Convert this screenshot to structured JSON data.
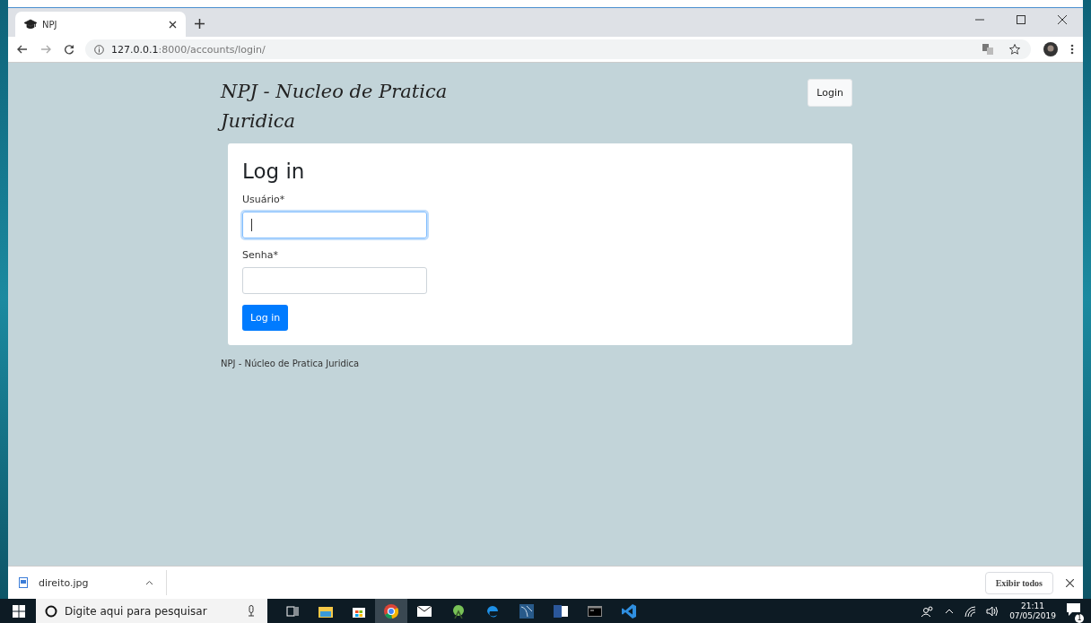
{
  "browser": {
    "tab": {
      "title": "NPJ",
      "selected": true
    },
    "url_host": "127.0.0.1",
    "url_path": ":8000/accounts/login/"
  },
  "page": {
    "brand": "NPJ - Nucleo de Pratica Juridica",
    "nav_button": "Login",
    "card": {
      "title": "Log in",
      "fields": [
        {
          "label": "Usuário*",
          "focused": true,
          "caret": true
        },
        {
          "label": "Senha*",
          "focused": false,
          "caret": false
        }
      ],
      "submit": "Log in"
    },
    "footer": "NPJ - Núcleo de Pratica Juridica"
  },
  "downloads": {
    "file": "direito.jpg",
    "show_all": "Exibir todos"
  },
  "taskbar": {
    "search_placeholder": "Digite aqui para pesquisar",
    "time": "21:11",
    "date": "07/05/2019",
    "notifications": "1"
  }
}
